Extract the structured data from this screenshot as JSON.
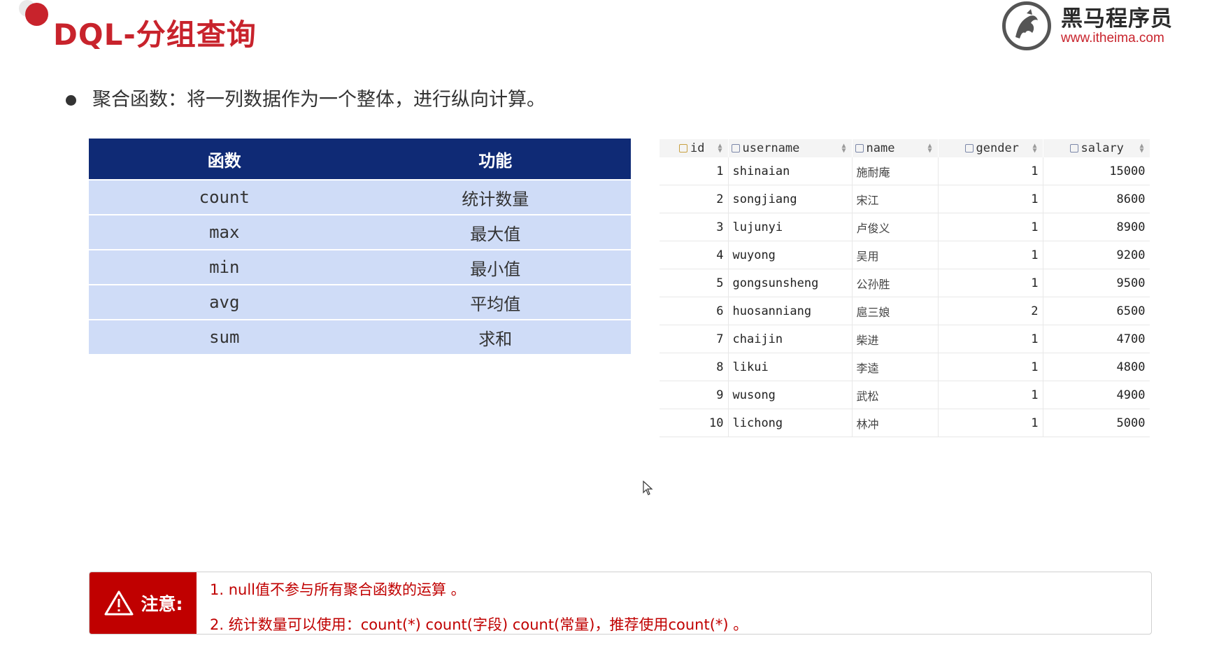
{
  "slide": {
    "title": "DQL-分组查询",
    "logo": {
      "name": "黑马程序员",
      "url": "www.itheima.com",
      "icon": "horse-logo-icon"
    },
    "bullet_text": "聚合函数：将一列数据作为一个整体，进行纵向计算。"
  },
  "func_table": {
    "headers": [
      "函数",
      "功能"
    ],
    "rows": [
      {
        "fn": "count",
        "desc": "统计数量"
      },
      {
        "fn": "max",
        "desc": "最大值"
      },
      {
        "fn": "min",
        "desc": "最小值"
      },
      {
        "fn": "avg",
        "desc": "平均值"
      },
      {
        "fn": "sum",
        "desc": "求和"
      }
    ],
    "colors": {
      "header_bg": "#0f2a75",
      "row_bg": "#cfdcf7"
    }
  },
  "data_grid": {
    "columns": [
      "id",
      "username",
      "name",
      "gender",
      "salary"
    ],
    "rows": [
      [
        "1",
        "shinaian",
        "施耐庵",
        "1",
        "15000"
      ],
      [
        "2",
        "songjiang",
        "宋江",
        "1",
        "8600"
      ],
      [
        "3",
        "lujunyi",
        "卢俊义",
        "1",
        "8900"
      ],
      [
        "4",
        "wuyong",
        "吴用",
        "1",
        "9200"
      ],
      [
        "5",
        "gongsunsheng",
        "公孙胜",
        "1",
        "9500"
      ],
      [
        "6",
        "huosanniang",
        "扈三娘",
        "2",
        "6500"
      ],
      [
        "7",
        "chaijin",
        "柴进",
        "1",
        "4700"
      ],
      [
        "8",
        "likui",
        "李逵",
        "1",
        "4800"
      ],
      [
        "9",
        "wusong",
        "武松",
        "1",
        "4900"
      ],
      [
        "10",
        "lichong",
        "林冲",
        "1",
        "5000"
      ]
    ]
  },
  "note": {
    "label": "注意:",
    "icon": "warning-icon",
    "line1": "1. null值不参与所有聚合函数的运算 。",
    "line2": "2. 统计数量可以使用：count(*)  count(字段) count(常量)，推荐使用count(*) 。"
  },
  "colors": {
    "accent": "#c8232c",
    "note_red": "#c00000"
  }
}
